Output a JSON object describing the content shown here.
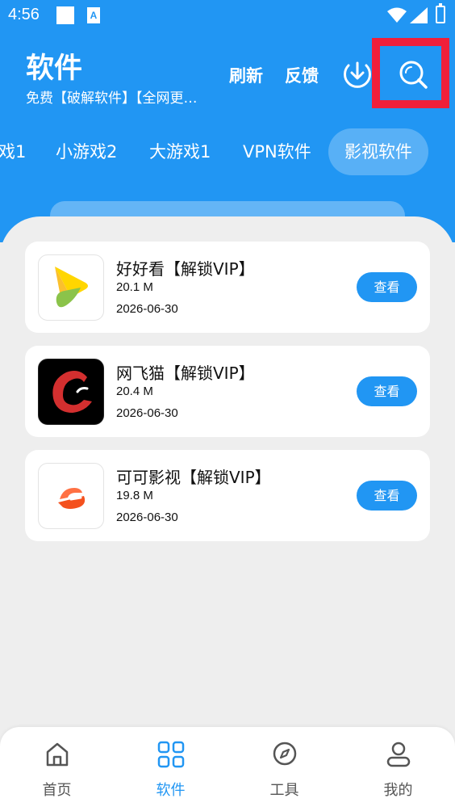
{
  "status_bar": {
    "time": "4:56",
    "notification_icon": "A"
  },
  "header": {
    "title": "软件",
    "subtitle": "免费【破解软件】【全网更…",
    "refresh_label": "刷新",
    "feedback_label": "反馈",
    "download_icon": "download-icon",
    "search_icon": "search-icon",
    "search_highlight_color": "#f01f3a"
  },
  "tabs": [
    {
      "label": "戏1",
      "active": false
    },
    {
      "label": "小游戏2",
      "active": false
    },
    {
      "label": "大游戏1",
      "active": false
    },
    {
      "label": "VPN软件",
      "active": false
    },
    {
      "label": "影视软件",
      "active": true
    }
  ],
  "apps": [
    {
      "name": "好好看【解锁VIP】",
      "size": "20.1 M",
      "date": "2026-06-30",
      "button": "查看"
    },
    {
      "name": "网飞猫【解锁VIP】",
      "size": "20.4 M",
      "date": "2026-06-30",
      "button": "查看"
    },
    {
      "name": "可可影视【解锁VIP】",
      "size": "19.8 M",
      "date": "2026-06-30",
      "button": "查看"
    }
  ],
  "bottom_nav": [
    {
      "label": "首页",
      "icon": "home-icon",
      "active": false
    },
    {
      "label": "软件",
      "icon": "grid-icon",
      "active": true
    },
    {
      "label": "工具",
      "icon": "compass-icon",
      "active": false
    },
    {
      "label": "我的",
      "icon": "user-icon",
      "active": false
    }
  ],
  "colors": {
    "primary": "#2196f3",
    "background": "#eeeeee",
    "card": "#ffffff"
  }
}
